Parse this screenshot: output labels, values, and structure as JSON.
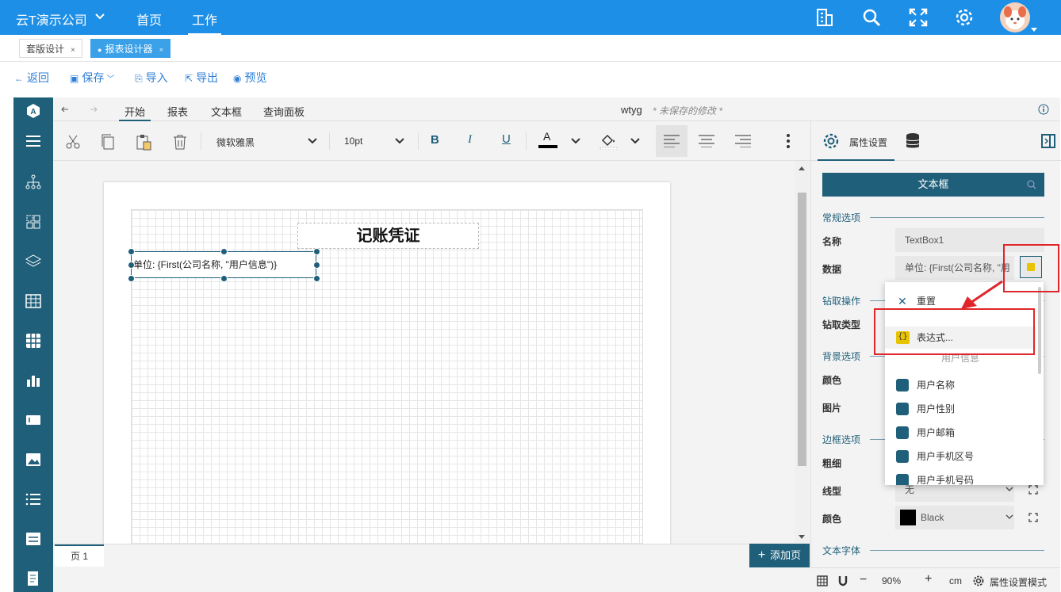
{
  "topbar": {
    "company": "云T演示公司",
    "nav": [
      {
        "label": "首页"
      },
      {
        "label": "工作"
      }
    ]
  },
  "tabs": [
    {
      "label": "套版设计",
      "close": "×"
    },
    {
      "label": "报表设计器",
      "close": "×"
    }
  ],
  "actions": {
    "back": "返回",
    "save": "保存",
    "import": "导入",
    "export": "导出",
    "preview": "预览"
  },
  "menubar": {
    "tabs": [
      "开始",
      "报表",
      "文本框",
      "查询面板"
    ],
    "doc_name": "wtyg",
    "unsaved": "* 未保存的修改 *"
  },
  "toolbar": {
    "font": "微软雅黑",
    "size": "10pt"
  },
  "report": {
    "title": "记账凭证",
    "textbox_value": "单位: {First(公司名称, \"用户信息\")}"
  },
  "bottom": {
    "page_tab": "页 1",
    "add_page": "添加页"
  },
  "status": {
    "zoom": "90%",
    "unit": "cm",
    "mode": "属性设置模式"
  },
  "panel": {
    "tab_label": "属性设置",
    "object": "文本框",
    "sections": {
      "general": "常规选项",
      "drill": "钻取操作",
      "background": "背景选项",
      "border": "边框选项",
      "font": "文本字体"
    },
    "labels": {
      "name": "名称",
      "data": "数据",
      "drill_type": "钻取类型",
      "color": "颜色",
      "image": "图片",
      "thickness": "粗细",
      "line_type": "线型",
      "border_color": "颜色"
    },
    "values": {
      "name": "TextBox1",
      "data": "单位: {First(公司名称, \"用",
      "line_type": "无",
      "border_color": "Black"
    }
  },
  "dropdown": {
    "reset": "重置",
    "expression": "表达式...",
    "group": "用户信息",
    "fields": [
      "用户名称",
      "用户性别",
      "用户邮箱",
      "用户手机区号",
      "用户手机号码"
    ]
  },
  "colors": {
    "brand": "#1e8fe6",
    "accent": "#1f5f7a",
    "highlight": "#e0262a"
  }
}
